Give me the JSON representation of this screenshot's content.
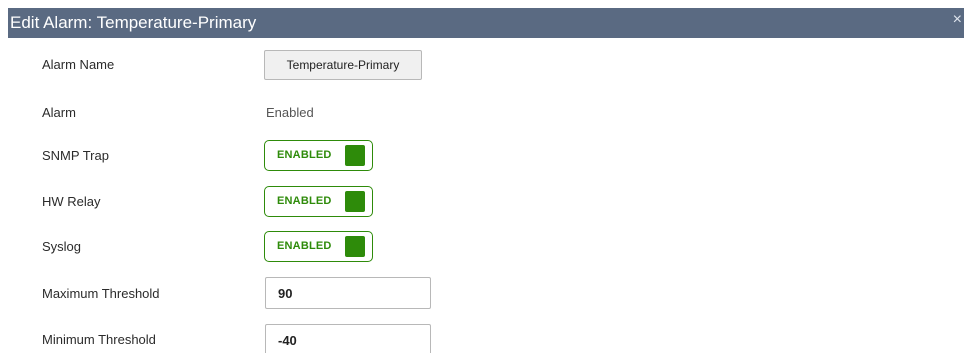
{
  "dialog": {
    "title": "Edit Alarm: Temperature-Primary",
    "close_icon": "close-icon",
    "close_symbol": "×"
  },
  "fields": {
    "alarm_name": {
      "label": "Alarm Name",
      "value": "Temperature-Primary"
    },
    "alarm": {
      "label": "Alarm",
      "value": "Enabled"
    },
    "snmp_trap": {
      "label": "SNMP Trap",
      "state": "ENABLED"
    },
    "hw_relay": {
      "label": "HW Relay",
      "state": "ENABLED"
    },
    "syslog": {
      "label": "Syslog",
      "state": "ENABLED"
    },
    "max_threshold": {
      "label": "Maximum Threshold",
      "value": "90"
    },
    "min_threshold": {
      "label": "Minimum Threshold",
      "value": "-40"
    }
  },
  "colors": {
    "title_bar": "#5a6a82",
    "toggle_on": "#2e8b0a"
  }
}
